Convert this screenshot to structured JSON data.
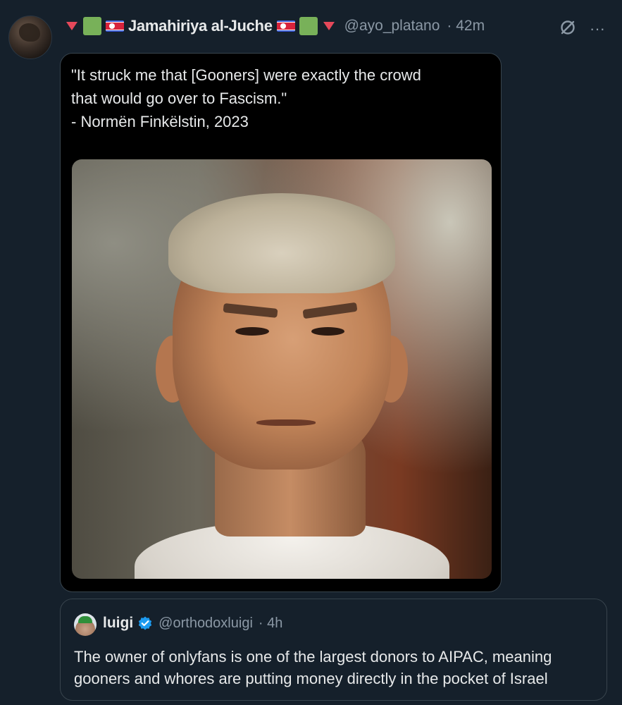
{
  "post": {
    "display_name": "Jamahiriya al-Juche",
    "handle": "@ayo_platano",
    "time": "· 42m",
    "text_lines": [
      "\"It struck me that [Gooners] were exactly the crowd",
      "that would go over to Fascism.\"",
      "- Normën Finkëlstin, 2023"
    ],
    "image_alt": "Portrait photo of a gray-haired man"
  },
  "header_icons": {
    "grok": "slashed-circle-icon",
    "more": "···"
  },
  "quoted": {
    "display_name": "luigi",
    "handle": "@orthodoxluigi",
    "time": "· 4h",
    "text_lines": [
      "The owner of onlyfans is one of the largest donors to AIPAC, meaning",
      "gooners and whores are putting money directly in the pocket of Israel"
    ]
  },
  "colors": {
    "background": "#15202b",
    "border": "#38444d",
    "text": "#e7e9ea",
    "muted": "#8b98a5",
    "verified": "#1d9bf0",
    "red_triangle": "#e5485a",
    "green_square": "#78b159"
  }
}
